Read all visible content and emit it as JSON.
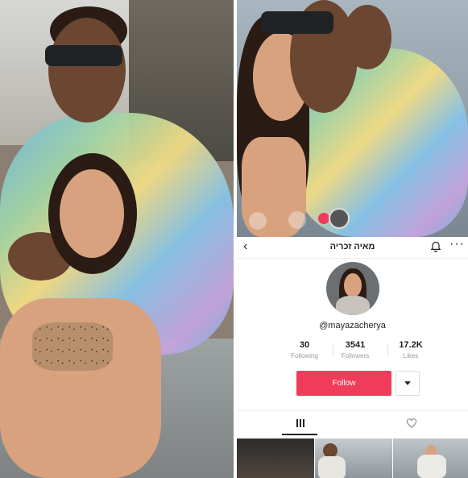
{
  "profile": {
    "display_name": "מאיה זכריה",
    "username": "@mayazacherya",
    "stats": [
      {
        "value": "30",
        "label": "Following"
      },
      {
        "value": "3541",
        "label": "Followers"
      },
      {
        "value": "17.2K",
        "label": "Likes"
      }
    ],
    "follow_label": "Follow"
  },
  "icons": {
    "back": "chevron-left-icon",
    "bell": "bell-icon",
    "more": "more-icon",
    "dropdown": "caret-down-icon",
    "grid": "grid-icon",
    "liked": "heart-icon"
  },
  "colors": {
    "follow_button": "#f03b5a"
  }
}
